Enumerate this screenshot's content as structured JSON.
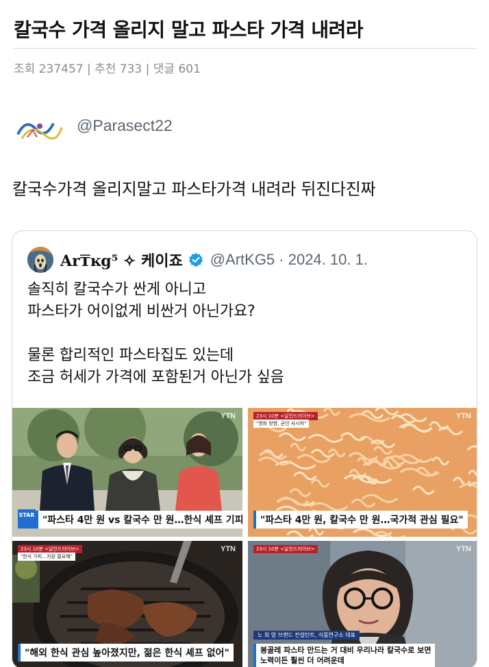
{
  "post": {
    "title": "칼국수 가격 올리지 말고 파스타 가격 내려라",
    "meta": "조회 237457 | 추천 733 | 댓글 601"
  },
  "tweet": {
    "handle": "@Parasect22",
    "text": "칼국수가격 올리지말고 파스타가격 내려라 뒤진다진짜"
  },
  "quoted_tweet": {
    "display_name": "Ar₸ĸg⁵ ✧ 케이죠",
    "handle_date": "@ArtKG5 · 2024. 10. 1.",
    "body_lines": [
      "솔직히 칼국수가 싼게 아니고",
      "파스타가 어이없게 비싼거 아닌가요?",
      "",
      "물론 합리적인 파스타집도 있는데",
      "조금 허세가 가격에 포함된거 아닌가 싶음"
    ],
    "media": [
      {
        "caption": "\"파스타 4만 원 vs 칼국수 만 원…한식 셰프 기피\"",
        "badge": "STAR",
        "watermark": "YTN"
      },
      {
        "caption": "\"파스타 4만 원, 칼국수 만 원…국가적 관심 필요\"",
        "watermark": "YTN",
        "tag": "23시 10분 <날인드라이브>",
        "subtag": "\"영화 방향, 균인 사시허\""
      },
      {
        "caption": "\"해외 한식 관심 높아졌지만, 젊은 한식 셰프 없어\"",
        "watermark": "YTN",
        "tag": "23시 10분 <날인드라이브>",
        "subtag": "\"한식 기피…지원 필요해\""
      },
      {
        "caption_line1": "봉골레 파스타 만드는 거 대비 우리나라 칼국수로 보면",
        "caption_line2": "노력이든 훨씬 더 어려운데",
        "name_tag": "노 희 영   브랜드 컨설턴트, 식품연구소 대표",
        "watermark": "YTN",
        "tag": "23시 10분 <날인드라이브>"
      }
    ]
  },
  "colors": {
    "verified": "#1d9bf0",
    "caption_accent": "#1e6fd0",
    "meta_gray": "#8a8a8a"
  }
}
